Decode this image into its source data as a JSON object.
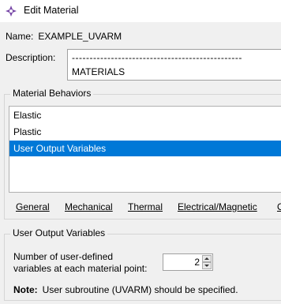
{
  "window": {
    "title": "Edit Material",
    "title_icon": "crosshair-icon"
  },
  "name": {
    "label": "Name:",
    "value": "EXAMPLE_UVARM"
  },
  "description": {
    "label": "Description:",
    "line1": "------------------------------------------------",
    "line2": "MATERIALS"
  },
  "material_behaviors": {
    "title": "Material Behaviors",
    "items": [
      "Elastic",
      "Plastic",
      "User Output Variables"
    ],
    "selected": "User Output Variables"
  },
  "menu": {
    "items": [
      "General",
      "Mechanical",
      "Thermal",
      "Electrical/Magnetic",
      "O"
    ]
  },
  "user_output_variables": {
    "title": "User Output Variables",
    "num_label_line1": "Number of user-defined",
    "num_label_line2": "variables at each material point:",
    "num_value": "2",
    "note_label": "Note:",
    "note_text": "User subroutine (UVARM) should be specified."
  }
}
